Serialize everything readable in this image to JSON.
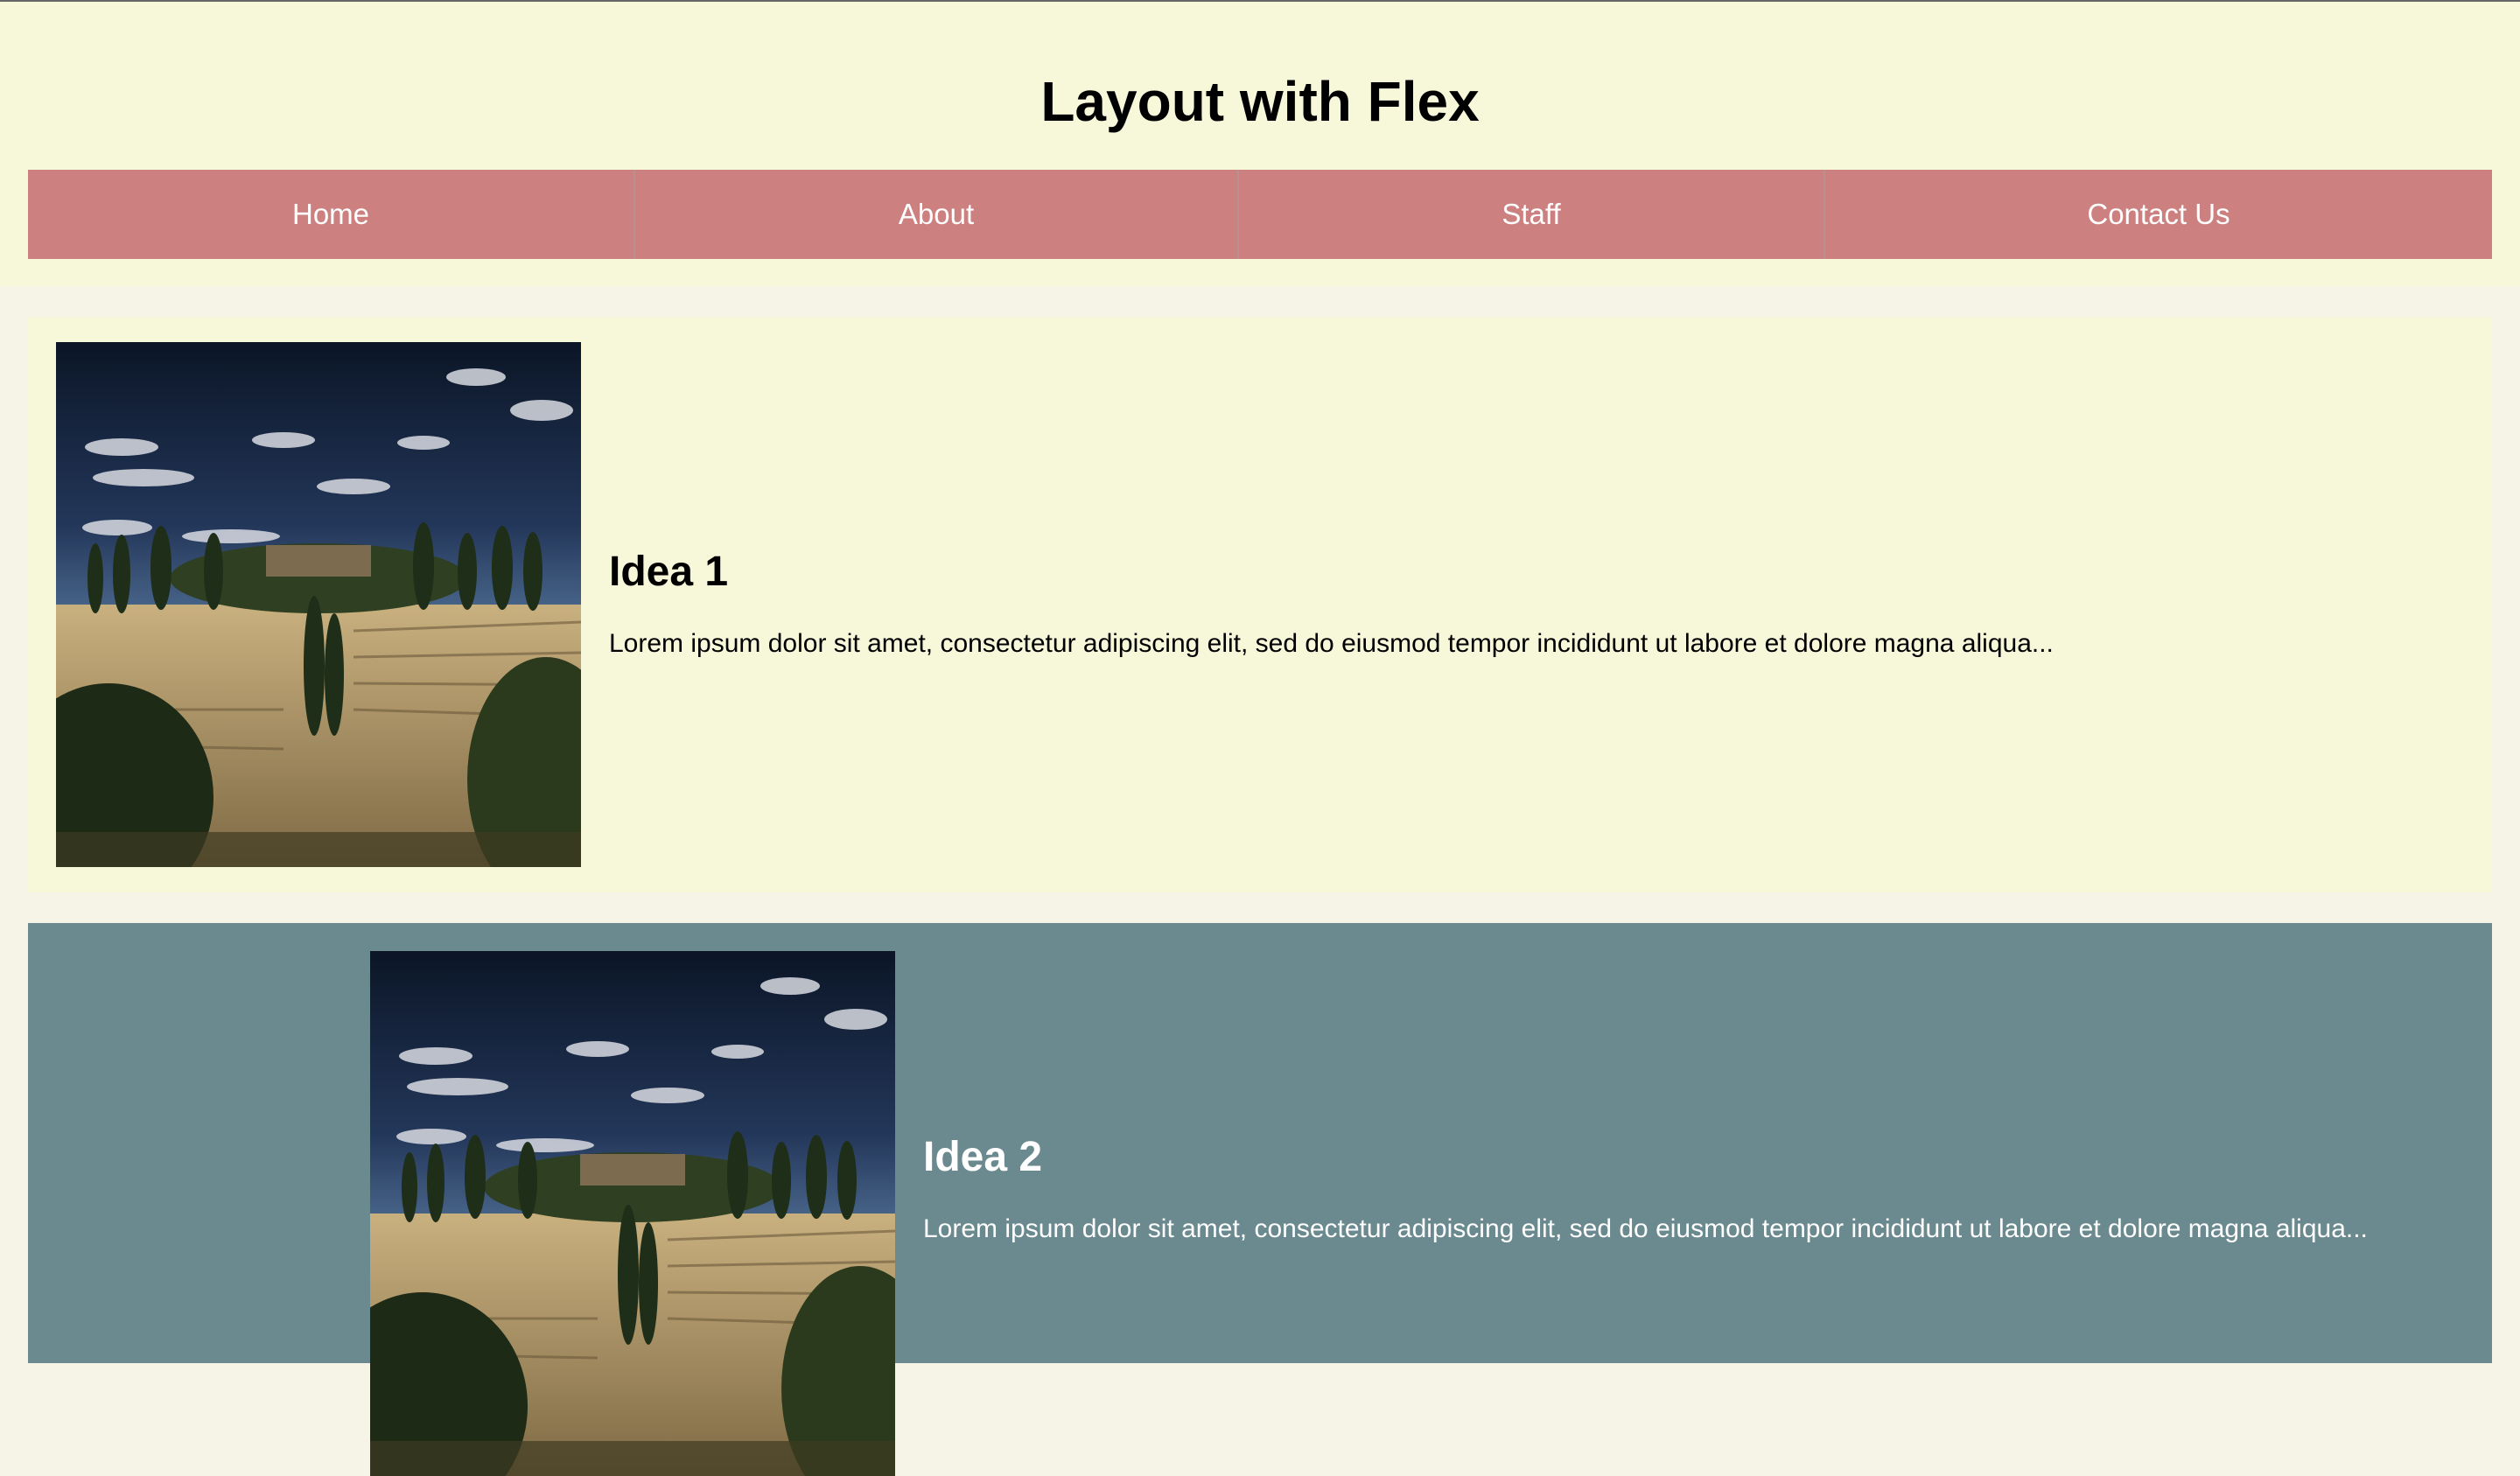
{
  "header": {
    "title": "Layout with Flex"
  },
  "nav": {
    "items": [
      {
        "label": "Home"
      },
      {
        "label": "About"
      },
      {
        "label": "Staff"
      },
      {
        "label": "Contact Us"
      }
    ]
  },
  "ideas": [
    {
      "title": "Idea 1",
      "text": "Lorem ipsum dolor sit amet, consectetur adipiscing elit, sed do eiusmod tempor incididunt ut labore et dolore magna aliqua...",
      "image": "tuscan-hill-landscape"
    },
    {
      "title": "Idea 2",
      "text": "Lorem ipsum dolor sit amet, consectetur adipiscing elit, sed do eiusmod tempor incididunt ut labore et dolore magna aliqua...",
      "image": "tuscan-hill-landscape"
    }
  ],
  "colors": {
    "header_bg": "#f7f7da",
    "nav_bg": "#cc8080",
    "idea1_bg": "#f7f7da",
    "idea2_bg": "#6a8a8f"
  }
}
